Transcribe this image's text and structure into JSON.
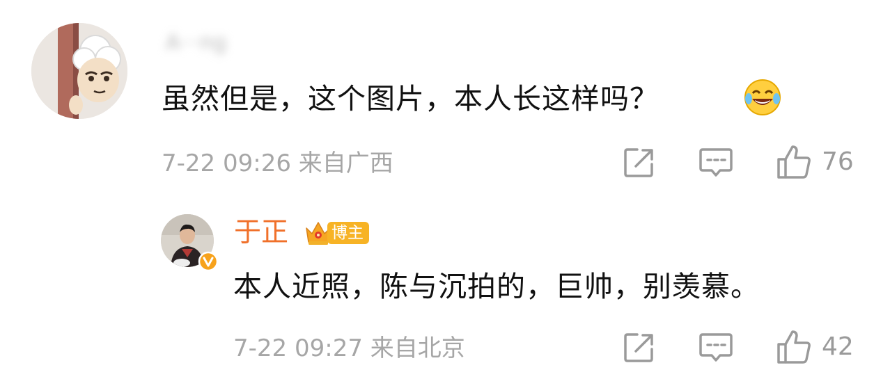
{
  "comment": {
    "avatar_icon": "cartoon-sheep-avatar",
    "username": "A···ng",
    "text": "虽然但是，这个图片，本人长这样吗？",
    "emoji": "laugh-cry-emoji",
    "timestamp": "7-22 09:26",
    "location": "来自广西",
    "like_count": "76"
  },
  "reply": {
    "avatar_icon": "man-portrait-avatar",
    "verified_icon": "verified-v-badge-icon",
    "author": "于正",
    "badge_label": "博主",
    "text": "本人近照，陈与沉拍的，巨帅，别羡慕。",
    "timestamp": "7-22 09:27",
    "location": "来自北京",
    "like_count": "42"
  },
  "colors": {
    "author_orange": "#f0702a",
    "badge_gold": "#f7b325",
    "meta_gray": "#a6a6a6",
    "icon_gray": "#9a9a9a"
  }
}
